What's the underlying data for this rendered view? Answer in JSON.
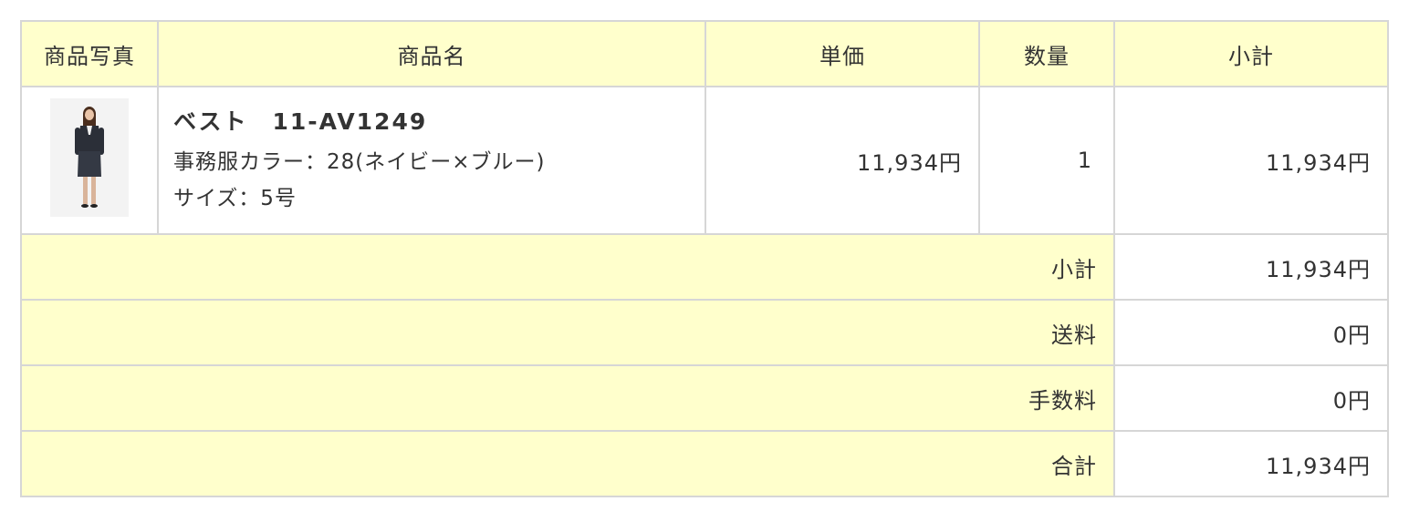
{
  "table": {
    "headers": {
      "photo": "商品写真",
      "name": "商品名",
      "unit_price": "単価",
      "quantity": "数量",
      "subtotal": "小計"
    },
    "item": {
      "name": "ベスト　11-AV1249",
      "color_option": "事務服カラー：28(ネイビー×ブルー)",
      "size_option": "サイズ：5号",
      "unit_price": "11,934円",
      "quantity": "1",
      "subtotal": "11,934円"
    },
    "summary": [
      {
        "label": "小計",
        "value": "11,934円"
      },
      {
        "label": "送料",
        "value": "0円"
      },
      {
        "label": "手数料",
        "value": "0円"
      },
      {
        "label": "合計",
        "value": "11,934円"
      }
    ]
  },
  "colors": {
    "header_bg": "#ffffcc",
    "border": "#d6d6d6",
    "text": "#333333"
  },
  "icons": {
    "product_photo": "woman-in-navy-suit"
  }
}
